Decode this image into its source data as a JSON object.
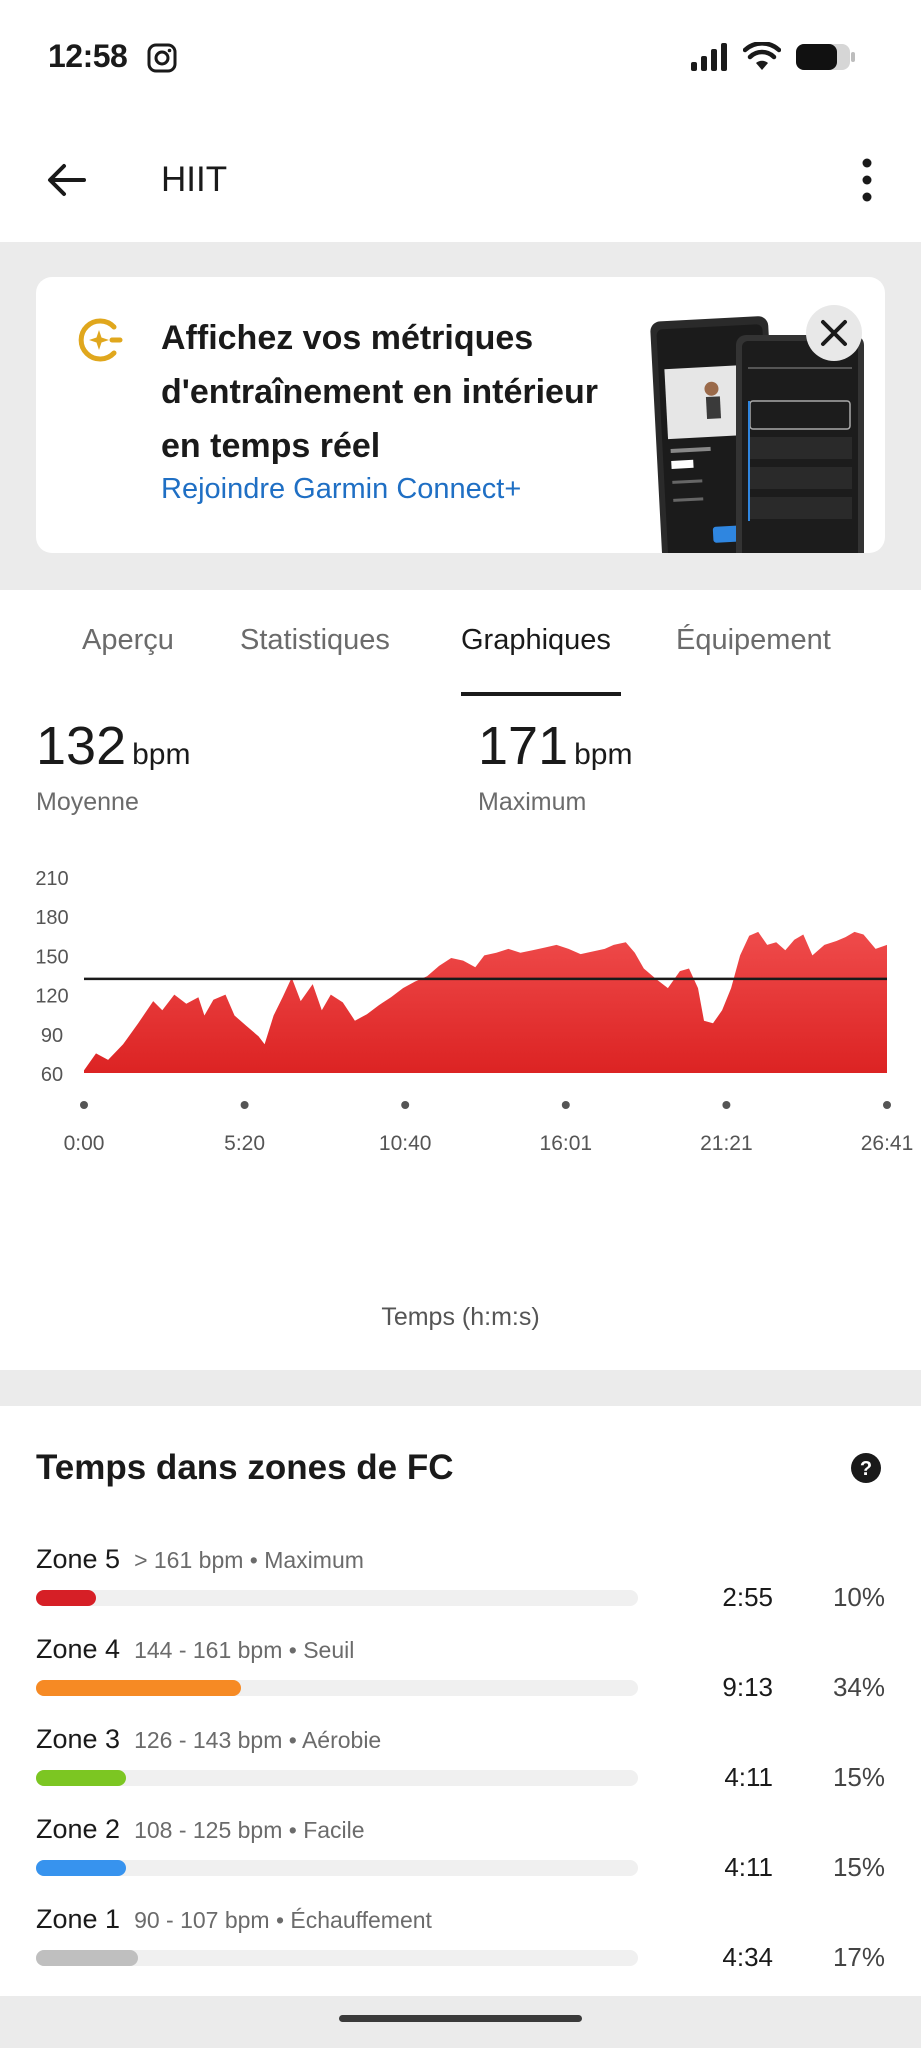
{
  "status": {
    "time": "12:58"
  },
  "app_bar": {
    "title": "HIIT"
  },
  "promo": {
    "text": "Affichez vos métriques d'entraînement en intérieur en temps réel",
    "link": "Rejoindre Garmin Connect+",
    "accent": "#e0a71d"
  },
  "tabs": [
    {
      "label": "Aperçu"
    },
    {
      "label": "Statistiques"
    },
    {
      "label": "Graphiques",
      "active": true
    },
    {
      "label": "Équipement"
    }
  ],
  "stats": {
    "average": {
      "value": "132",
      "unit": "bpm",
      "label": "Moyenne"
    },
    "maximum": {
      "value": "171",
      "unit": "bpm",
      "label": "Maximum"
    }
  },
  "chart_data": {
    "type": "area",
    "ylim": [
      60,
      210
    ],
    "yticks": [
      "210",
      "180",
      "150",
      "120",
      "90",
      "60"
    ],
    "xticks": [
      "0:00",
      "5:20",
      "10:40",
      "16:01",
      "21:21",
      "26:41"
    ],
    "xlabel": "Temps (h:m:s)",
    "average_line": 132,
    "color": "#e32b2b",
    "x_range_min": [
      0,
      26.68
    ],
    "series": [
      {
        "values": [
          [
            0,
            62
          ],
          [
            0.4,
            75
          ],
          [
            0.8,
            70
          ],
          [
            1.3,
            82
          ],
          [
            1.8,
            98
          ],
          [
            2.3,
            115
          ],
          [
            2.6,
            108
          ],
          [
            3.0,
            120
          ],
          [
            3.4,
            113
          ],
          [
            3.8,
            118
          ],
          [
            4.0,
            104
          ],
          [
            4.3,
            116
          ],
          [
            4.7,
            120
          ],
          [
            5.0,
            104
          ],
          [
            5.4,
            96
          ],
          [
            5.8,
            88
          ],
          [
            6.0,
            82
          ],
          [
            6.3,
            104
          ],
          [
            6.6,
            118
          ],
          [
            6.9,
            133
          ],
          [
            7.2,
            115
          ],
          [
            7.6,
            128
          ],
          [
            7.9,
            108
          ],
          [
            8.2,
            120
          ],
          [
            8.6,
            114
          ],
          [
            9.0,
            100
          ],
          [
            9.4,
            105
          ],
          [
            9.8,
            112
          ],
          [
            10.2,
            118
          ],
          [
            10.6,
            125
          ],
          [
            11.0,
            130
          ],
          [
            11.4,
            134
          ],
          [
            11.8,
            142
          ],
          [
            12.2,
            148
          ],
          [
            12.6,
            146
          ],
          [
            13.0,
            141
          ],
          [
            13.3,
            150
          ],
          [
            13.7,
            152
          ],
          [
            14.1,
            155
          ],
          [
            14.5,
            152
          ],
          [
            14.9,
            154
          ],
          [
            15.3,
            156
          ],
          [
            15.7,
            158
          ],
          [
            16.1,
            155
          ],
          [
            16.5,
            151
          ],
          [
            16.9,
            153
          ],
          [
            17.3,
            155
          ],
          [
            17.6,
            158
          ],
          [
            18.0,
            160
          ],
          [
            18.3,
            152
          ],
          [
            18.6,
            140
          ],
          [
            19.0,
            132
          ],
          [
            19.4,
            125
          ],
          [
            19.8,
            138
          ],
          [
            20.1,
            140
          ],
          [
            20.4,
            125
          ],
          [
            20.6,
            100
          ],
          [
            20.9,
            98
          ],
          [
            21.2,
            108
          ],
          [
            21.5,
            125
          ],
          [
            21.8,
            150
          ],
          [
            22.1,
            165
          ],
          [
            22.4,
            168
          ],
          [
            22.7,
            158
          ],
          [
            23.0,
            160
          ],
          [
            23.3,
            154
          ],
          [
            23.6,
            162
          ],
          [
            23.9,
            166
          ],
          [
            24.2,
            150
          ],
          [
            24.6,
            158
          ],
          [
            25.0,
            161
          ],
          [
            25.3,
            164
          ],
          [
            25.6,
            168
          ],
          [
            25.9,
            166
          ],
          [
            26.3,
            155
          ],
          [
            26.68,
            158
          ]
        ]
      }
    ]
  },
  "zones": {
    "title": "Temps dans zones de FC",
    "items": [
      {
        "name": "Zone 5",
        "range": "> 161 bpm • Maximum",
        "time": "2:55",
        "pct": "10%",
        "fraction": 0.1,
        "color": "#d61f26"
      },
      {
        "name": "Zone 4",
        "range": "144 - 161 bpm • Seuil",
        "time": "9:13",
        "pct": "34%",
        "fraction": 0.34,
        "color": "#f68a24"
      },
      {
        "name": "Zone 3",
        "range": "126 - 143 bpm • Aérobie",
        "time": "4:11",
        "pct": "15%",
        "fraction": 0.15,
        "color": "#7cc622"
      },
      {
        "name": "Zone 2",
        "range": "108 - 125 bpm • Facile",
        "time": "4:11",
        "pct": "15%",
        "fraction": 0.15,
        "color": "#3793ee"
      },
      {
        "name": "Zone 1",
        "range": "90 - 107 bpm • Échauffement",
        "time": "4:34",
        "pct": "17%",
        "fraction": 0.17,
        "color": "#bfbfbf"
      }
    ]
  }
}
